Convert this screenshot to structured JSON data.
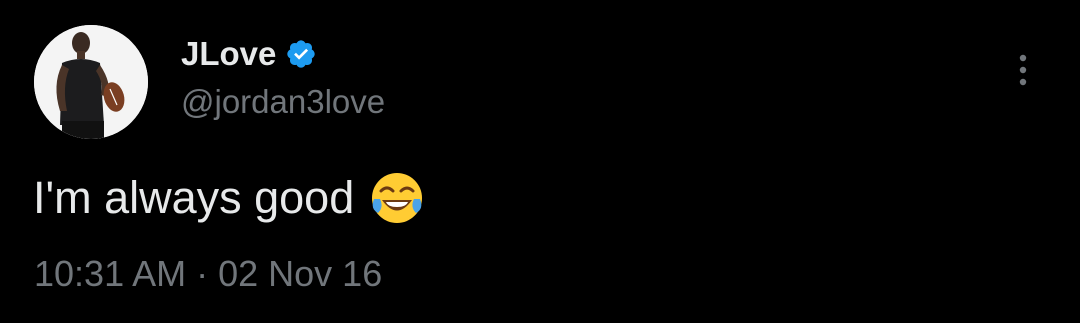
{
  "tweet": {
    "author": {
      "display_name": "JLove",
      "handle": "@jordan3love",
      "verified": true,
      "avatar_icon": "profile-photo"
    },
    "text": "I'm always good",
    "emoji": "face-with-tears-of-joy",
    "time": "10:31 AM",
    "separator": "·",
    "date": "02 Nov 16",
    "more_icon": "more-vertical-icon"
  },
  "colors": {
    "background": "#000000",
    "primary_text": "#e7e9ea",
    "secondary_text": "#71767b",
    "verified_blue": "#1d9bf0"
  }
}
